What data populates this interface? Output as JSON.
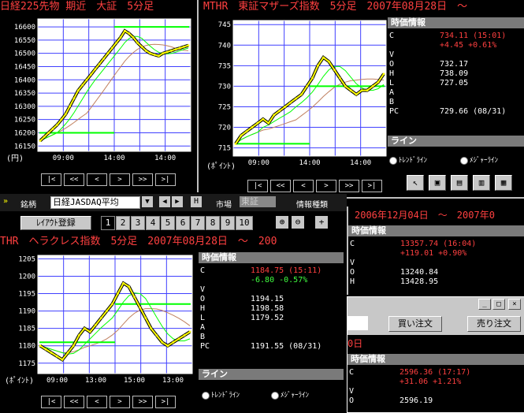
{
  "colors": {
    "title": "#ff4040",
    "price_line": "#ffff00",
    "hline": "#00ff00",
    "ma_short": "#00ff00",
    "ma_long": "#c08060",
    "grid": "#4040ff",
    "panel_header": "#7a7a7a"
  },
  "nikkei": {
    "title": "日経225先物 期近　大証　5分足",
    "unit": "(円)",
    "nav": [
      "|<",
      "<<",
      "<",
      ">",
      ">>",
      ">|"
    ],
    "chart_data": {
      "type": "line",
      "title": "日経225先物 期近　大証　5分足",
      "yticks": [
        16600,
        16550,
        16500,
        16450,
        16400,
        16350,
        16300,
        16250,
        16200,
        16150
      ],
      "xticks": [
        "09:00",
        "14:00",
        "14:00"
      ],
      "ylim": [
        16130,
        16630
      ],
      "series": [
        {
          "values": [
            16170,
            16185,
            16200,
            16215,
            16230,
            16250,
            16270,
            16300,
            16330,
            16360,
            16380,
            16400,
            16420,
            16440,
            16460,
            16480,
            16500,
            16520,
            16540,
            16560,
            16585,
            16575,
            16560,
            16540,
            16525,
            16510,
            16500,
            16495,
            16490,
            16500,
            16505,
            16510,
            16515,
            16520,
            16525,
            16530
          ]
        }
      ],
      "hlines": [
        16200,
        16600
      ]
    }
  },
  "mthr": {
    "title": "MTHR　東証マザーズ指数　5分足　2007年08月28日　～",
    "unit": "(ﾎﾟｲﾝﾄ)",
    "nav": [
      "|<",
      "<<",
      "<",
      ">",
      ">>",
      ">|"
    ],
    "chart_data": {
      "type": "line",
      "yticks": [
        745,
        740,
        735,
        730,
        725,
        720,
        715
      ],
      "xticks": [
        "09:00",
        "14:00",
        "14:00"
      ],
      "ylim": [
        713,
        746
      ],
      "series": [
        {
          "values": [
            716,
            718,
            719,
            720,
            721,
            722,
            721,
            723,
            724,
            725,
            726,
            727,
            728,
            730,
            732,
            735,
            737,
            736,
            734,
            732,
            730,
            729,
            728,
            729,
            729,
            730,
            731,
            733
          ]
        }
      ],
      "hlines": [
        716,
        730
      ]
    },
    "info": {
      "header": "時価情報",
      "rows": [
        {
          "k": "C",
          "v": "734.11 (15:01)",
          "red": true
        },
        {
          "k": "",
          "v": "+4.45 +0.61%",
          "red": true
        },
        {
          "k": "V",
          "v": ""
        },
        {
          "k": "O",
          "v": "732.17"
        },
        {
          "k": "H",
          "v": "738.09"
        },
        {
          "k": "L",
          "v": "727.05"
        },
        {
          "k": "A",
          "v": ""
        },
        {
          "k": "B",
          "v": ""
        },
        {
          "k": "PC",
          "v": "729.66 (08/31)"
        }
      ],
      "line_header": "ライン",
      "radio1": "ﾄﾚﾝﾄﾞﾗｲﾝ",
      "radio2": "ﾒｼﾞｬｰﾗｲﾝ"
    }
  },
  "toolbar": {
    "brand_label": "銘柄",
    "brand_value": "日経JASDAQ平均",
    "market_label": "市場",
    "market_value": "東証",
    "info_label": "情報種類",
    "layout_btn": "ﾚｲｱｳﾄ登録",
    "pages": [
      "1",
      "2",
      "3",
      "4",
      "5",
      "6",
      "7",
      "8",
      "9",
      "10"
    ]
  },
  "hercules": {
    "title": "THR　ヘラクレス指数　5分足　2007年08月28日　～　200",
    "unit": "(ﾎﾟｲﾝﾄ)",
    "nav": [
      "|<",
      "<<",
      "<",
      ">",
      ">>",
      ">|"
    ],
    "chart_data": {
      "type": "line",
      "yticks": [
        1205,
        1200,
        1195,
        1190,
        1185,
        1180,
        1175
      ],
      "xticks": [
        "09:00",
        "13:00",
        "15:00",
        "13:00"
      ],
      "ylim": [
        1172,
        1206
      ],
      "series": [
        {
          "values": [
            1180,
            1179,
            1178,
            1177,
            1176,
            1178,
            1180,
            1183,
            1185,
            1184,
            1186,
            1188,
            1190,
            1192,
            1195,
            1198,
            1197,
            1194,
            1191,
            1188,
            1185,
            1183,
            1181,
            1180,
            1181,
            1182,
            1183,
            1184
          ]
        }
      ],
      "hlines": [
        1181,
        1192
      ]
    },
    "info": {
      "header": "時価情報",
      "rows": [
        {
          "k": "C",
          "v": "1184.75 (15:11)",
          "red": true
        },
        {
          "k": "",
          "v": "-6.80 -0.57%",
          "green": true
        },
        {
          "k": "V",
          "v": ""
        },
        {
          "k": "O",
          "v": "1194.15"
        },
        {
          "k": "H",
          "v": "1198.58"
        },
        {
          "k": "L",
          "v": "1179.52"
        },
        {
          "k": "A",
          "v": ""
        },
        {
          "k": "B",
          "v": ""
        },
        {
          "k": "PC",
          "v": "1191.55 (08/31)"
        }
      ],
      "line_header": "ライン",
      "radio1": "ﾄﾚﾝﾄﾞﾗｲﾝ",
      "radio2": "ﾒｼﾞｬｰﾗｲﾝ"
    }
  },
  "right_top": {
    "date_range": "2006年12月04日　～　2007年0",
    "info": {
      "header": "時価情報",
      "rows": [
        {
          "k": "C",
          "v": "13357.74 (16:04)",
          "red": true
        },
        {
          "k": "",
          "v": "+119.01 +0.90%",
          "red": true
        },
        {
          "k": "V",
          "v": ""
        },
        {
          "k": "O",
          "v": "13240.84"
        },
        {
          "k": "H",
          "v": "13428.95"
        }
      ]
    }
  },
  "order_win": {
    "buy": "買い注文",
    "sell": "売り注文",
    "date_fragment": "0日",
    "info": {
      "header": "時価情報",
      "rows": [
        {
          "k": "C",
          "v": "2596.36 (17:17)",
          "red": true
        },
        {
          "k": "",
          "v": "+31.06 +1.21%",
          "red": true
        },
        {
          "k": "V",
          "v": ""
        },
        {
          "k": "O",
          "v": "2596.19"
        }
      ]
    }
  }
}
